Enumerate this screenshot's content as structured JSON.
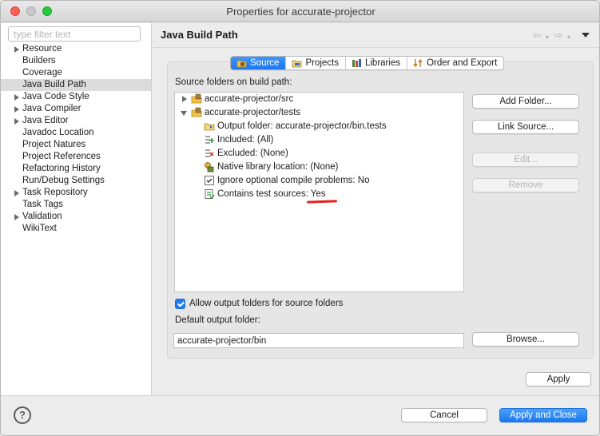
{
  "window": {
    "title": "Properties for accurate-projector"
  },
  "filter": {
    "placeholder": "type filter text"
  },
  "nav": {
    "items": [
      {
        "label": "Resource",
        "expandable": true
      },
      {
        "label": "Builders",
        "expandable": false
      },
      {
        "label": "Coverage",
        "expandable": false
      },
      {
        "label": "Java Build Path",
        "expandable": false,
        "selected": true
      },
      {
        "label": "Java Code Style",
        "expandable": true
      },
      {
        "label": "Java Compiler",
        "expandable": true
      },
      {
        "label": "Java Editor",
        "expandable": true
      },
      {
        "label": "Javadoc Location",
        "expandable": false
      },
      {
        "label": "Project Natures",
        "expandable": false
      },
      {
        "label": "Project References",
        "expandable": false
      },
      {
        "label": "Refactoring History",
        "expandable": false
      },
      {
        "label": "Run/Debug Settings",
        "expandable": false
      },
      {
        "label": "Task Repository",
        "expandable": true
      },
      {
        "label": "Task Tags",
        "expandable": false
      },
      {
        "label": "Validation",
        "expandable": true
      },
      {
        "label": "WikiText",
        "expandable": false
      }
    ]
  },
  "page": {
    "title": "Java Build Path"
  },
  "tabs": [
    {
      "label": "Source",
      "icon": "source-folder-icon",
      "active": true
    },
    {
      "label": "Projects",
      "icon": "projects-icon",
      "active": false
    },
    {
      "label": "Libraries",
      "icon": "libraries-icon",
      "active": false
    },
    {
      "label": "Order and Export",
      "icon": "order-export-icon",
      "active": false
    }
  ],
  "source": {
    "label": "Source folders on build path:",
    "tree": [
      {
        "label": "accurate-projector/src",
        "icon": "package-folder-icon",
        "expanded": false
      },
      {
        "label": "accurate-projector/tests",
        "icon": "package-folder-icon",
        "expanded": true
      },
      {
        "label": "Output folder: accurate-projector/bin.tests",
        "icon": "output-folder-icon"
      },
      {
        "label": "Included: (All)",
        "icon": "inclusion-filter-icon"
      },
      {
        "label": "Excluded: (None)",
        "icon": "exclusion-filter-icon"
      },
      {
        "label": "Native library location: (None)",
        "icon": "native-library-icon"
      },
      {
        "label": "Ignore optional compile problems: No",
        "icon": "ignore-problems-icon"
      },
      {
        "label": "Contains test sources: Yes",
        "icon": "test-source-icon"
      }
    ],
    "buttons": {
      "add_folder": "Add Folder...",
      "link_source": "Link Source...",
      "edit": "Edit...",
      "remove": "Remove"
    },
    "allow_output": {
      "label": "Allow output folders for source folders",
      "checked": true
    },
    "default_output": {
      "label": "Default output folder:",
      "value": "accurate-projector/bin",
      "browse": "Browse..."
    }
  },
  "footer": {
    "apply": "Apply",
    "cancel": "Cancel",
    "apply_close": "Apply and Close",
    "help": "?"
  },
  "colors": {
    "accent": "#1f7cf1",
    "annotation": "#e8211d"
  }
}
